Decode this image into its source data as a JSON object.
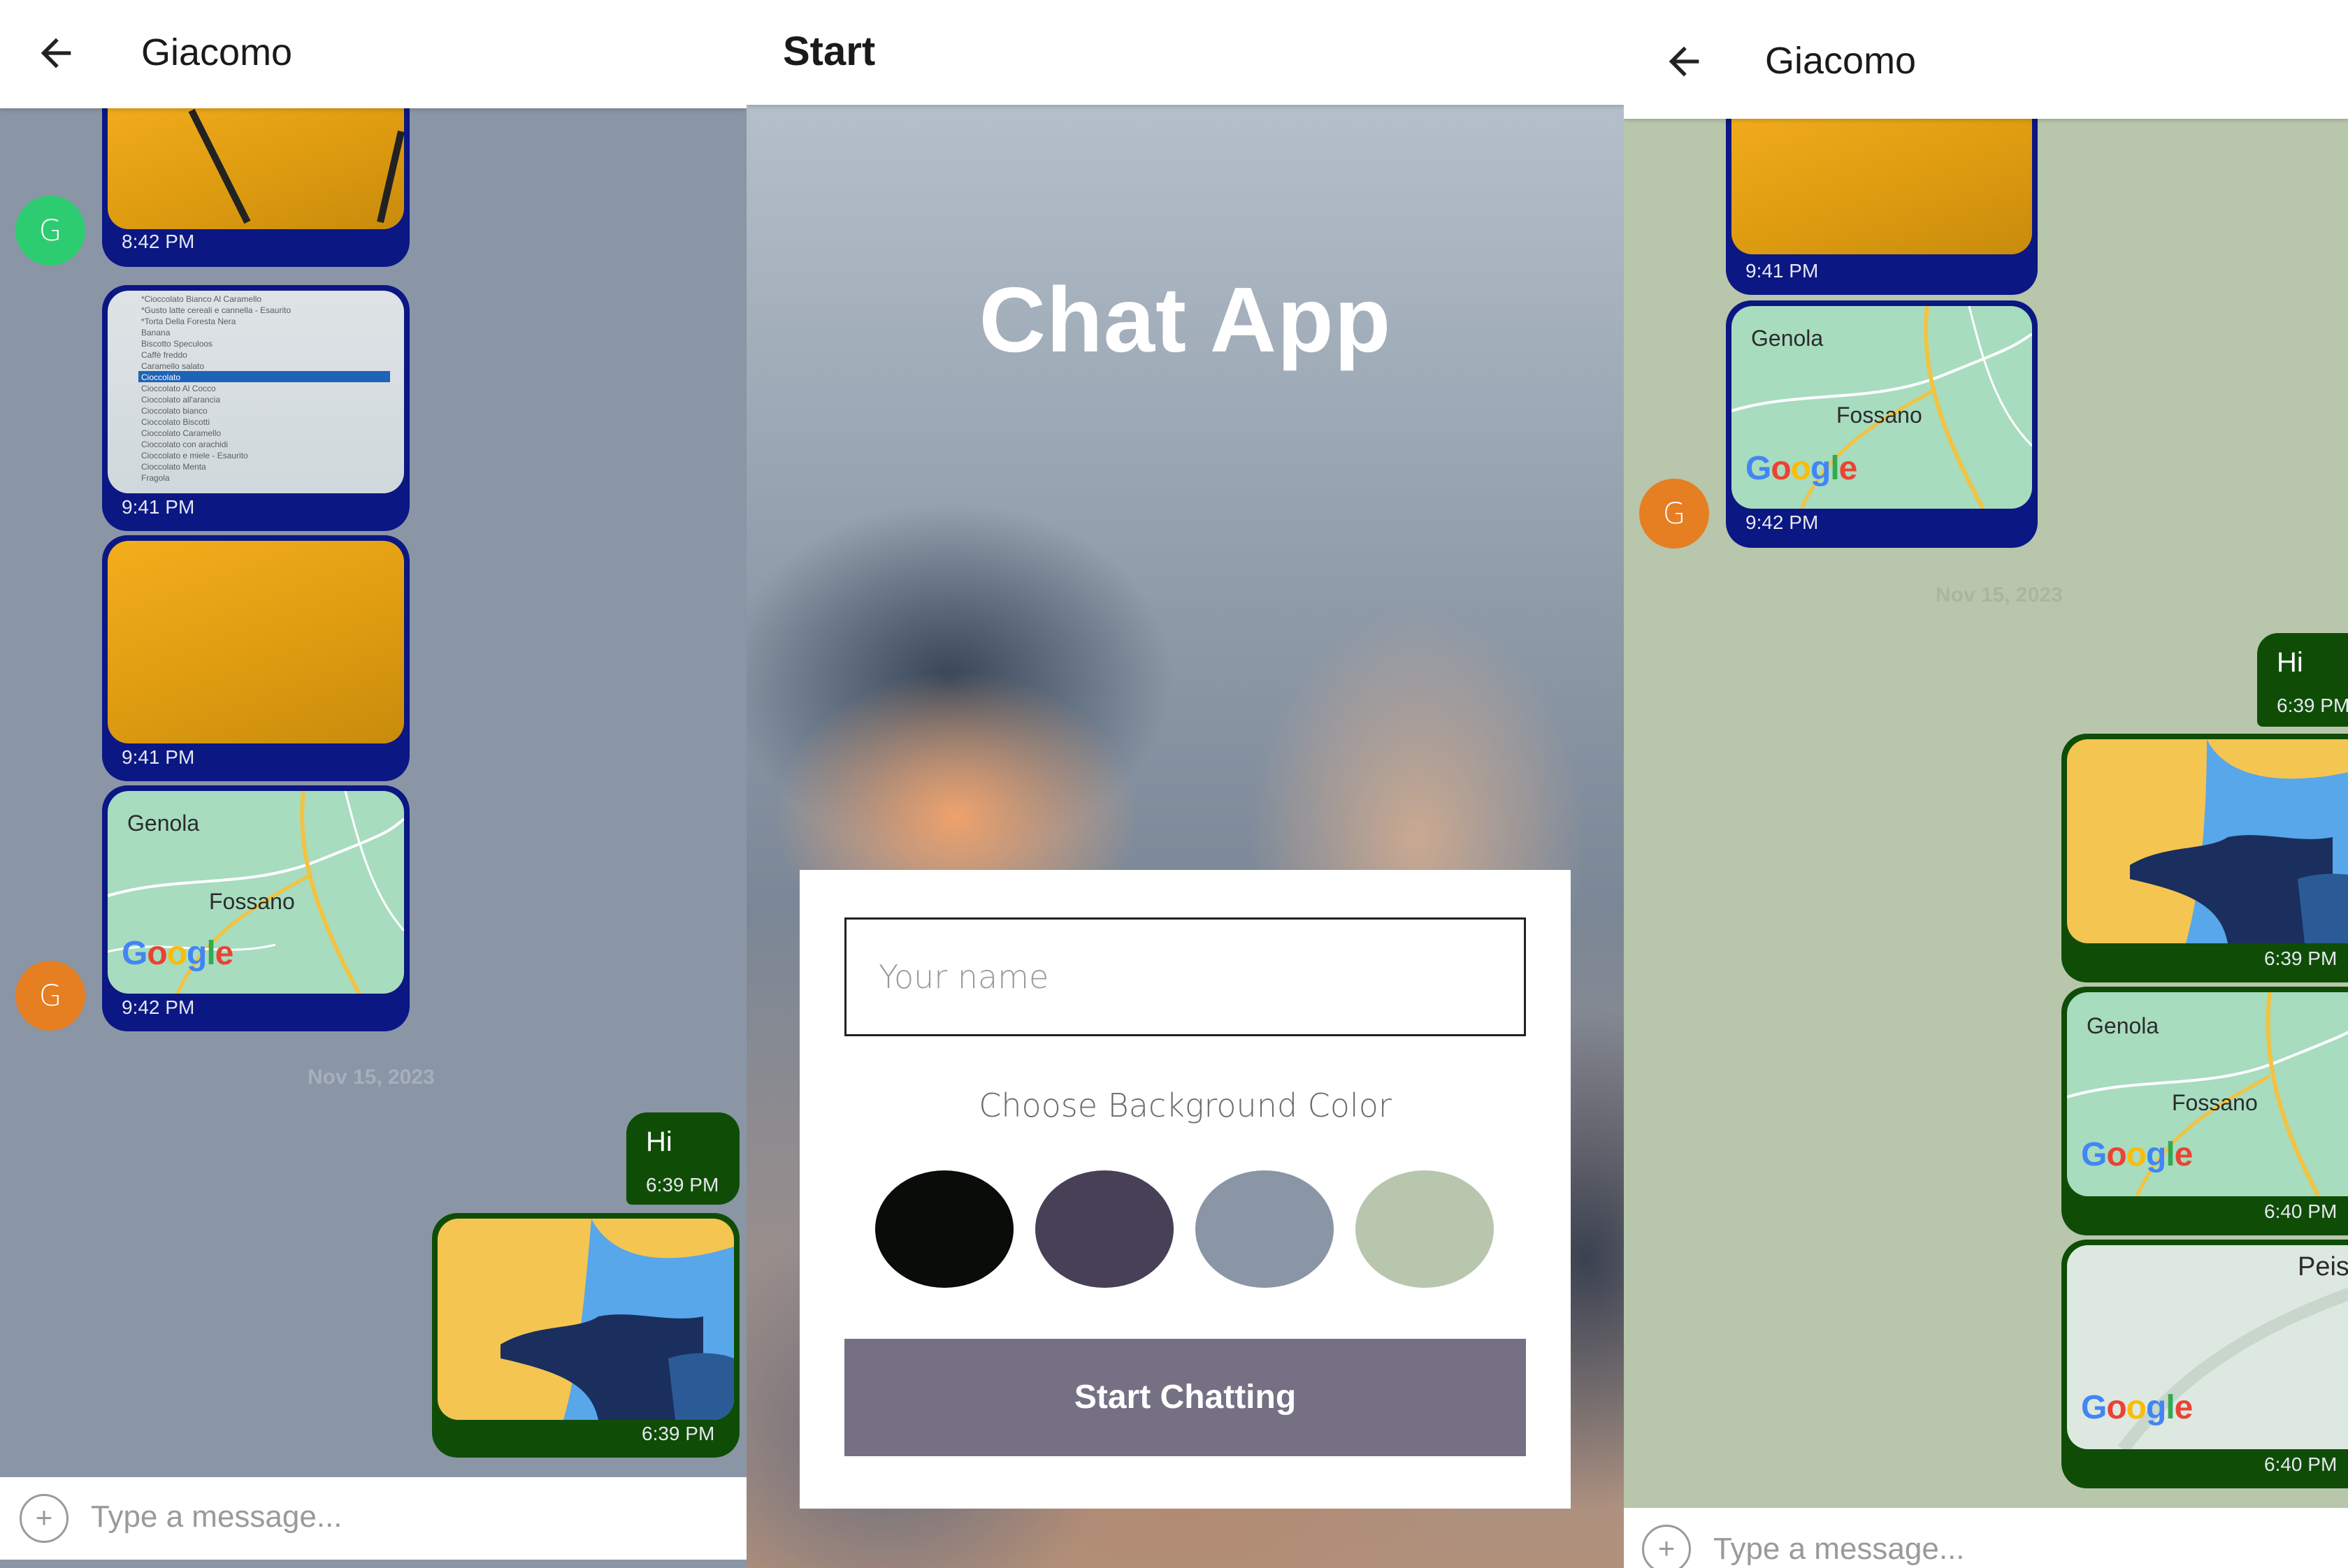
{
  "left_chat": {
    "title": "Giacomo",
    "background_color": "#8a96a6",
    "avatar_initial_1": "G",
    "avatar_color_1": "#2ecc71",
    "avatar_initial_2": "G",
    "avatar_color_2": "#e67e22",
    "messages": [
      {
        "kind": "image",
        "time": "8:42 PM"
      },
      {
        "kind": "image",
        "time": "9:41 PM"
      },
      {
        "kind": "image",
        "time": "9:41 PM"
      },
      {
        "kind": "map",
        "time": "9:42 PM"
      }
    ],
    "date_separator": "Nov 15, 2023",
    "sent": [
      {
        "kind": "text",
        "text": "Hi",
        "time": "6:39 PM"
      },
      {
        "kind": "image",
        "time": "6:39 PM"
      }
    ],
    "composer_placeholder": "Type a message..."
  },
  "document_photo_lines": [
    "*Cioccolato Bianco Al Caramello",
    "*Gusto latte cereali e cannella - Esaurito",
    "*Torta Della Foresta Nera",
    "Banana",
    "Biscotto Speculoos",
    "Caffè freddo",
    "Caramello salato",
    "Cioccolato",
    "Cioccolato Al Cocco",
    "Cioccolato all'arancia",
    "Cioccolato bianco",
    "Cioccolato Biscotti",
    "Cioccolato Caramello",
    "Cioccolato con arachidi",
    "Cioccolato e miele - Esaurito",
    "Cioccolato Menta",
    "Fragola"
  ],
  "map": {
    "label_genola": "Genola",
    "label_fossano": "Fossano",
    "label_peis": "Peis",
    "logo": [
      "G",
      "o",
      "o",
      "g",
      "l",
      "e"
    ]
  },
  "start_screen": {
    "header_title": "Start",
    "app_title": "Chat App",
    "name_placeholder": "Your name",
    "choose_label": "Choose Background Color",
    "swatches": [
      "#090c08",
      "#474056",
      "#8a95a5",
      "#b9c6ae"
    ],
    "button_label": "Start Chatting",
    "button_color": "#757083"
  },
  "right_chat": {
    "title": "Giacomo",
    "background_color": "#b8c6ab",
    "avatar_initial": "G",
    "avatar_color": "#e67e22",
    "received": [
      {
        "kind": "image",
        "time": "9:41 PM"
      },
      {
        "kind": "map",
        "time": "9:42 PM"
      }
    ],
    "date_separator": "Nov 15, 2023",
    "sent": [
      {
        "kind": "text",
        "text": "Hi",
        "time": "6:39 PM"
      },
      {
        "kind": "image",
        "time": "6:39 PM"
      },
      {
        "kind": "map",
        "time": "6:40 PM"
      },
      {
        "kind": "map",
        "time": "6:40 PM"
      }
    ],
    "composer_placeholder": "Type a message..."
  }
}
